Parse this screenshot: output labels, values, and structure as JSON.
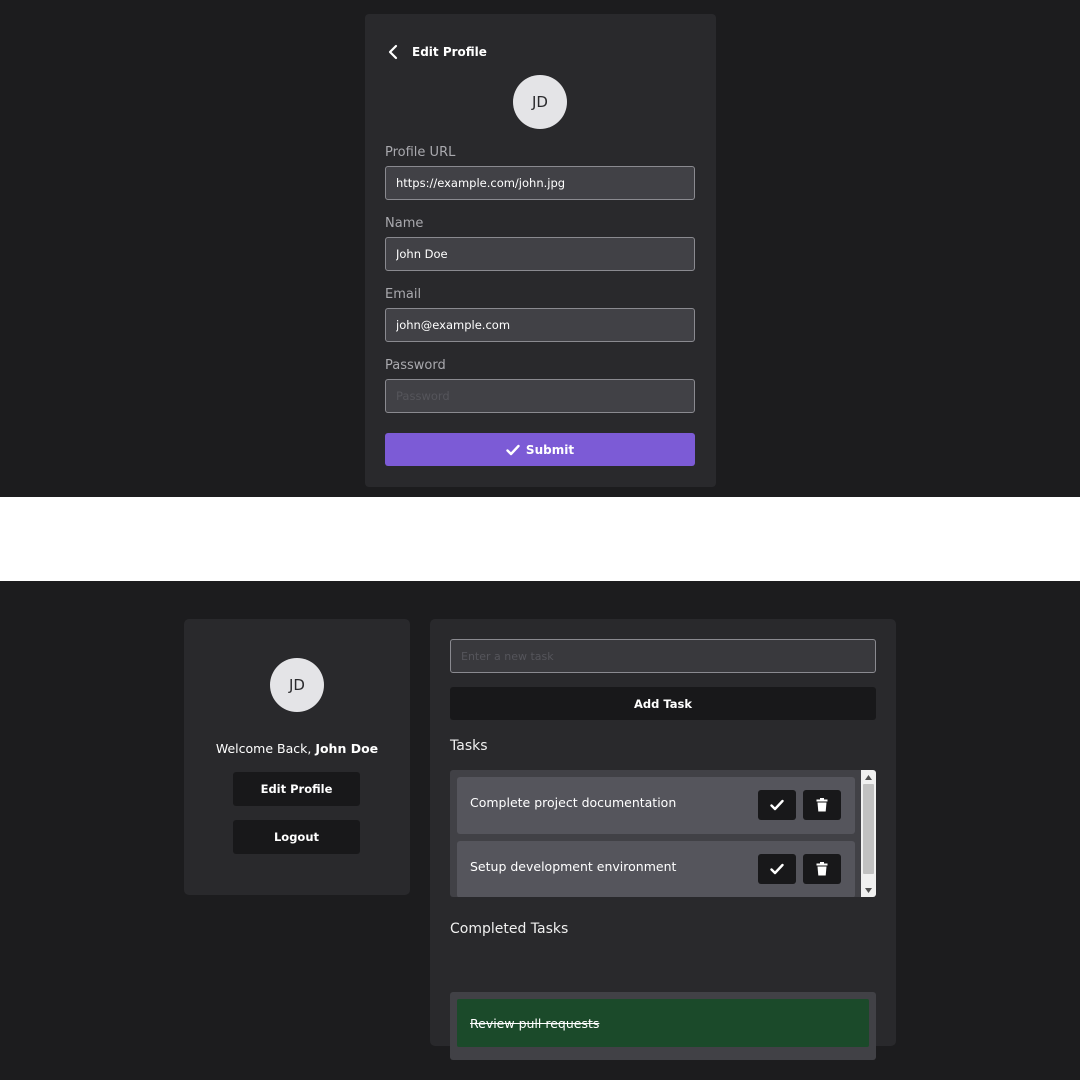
{
  "edit_profile": {
    "title": "Edit Profile",
    "avatar_initials": "JD",
    "fields": {
      "profile_url": {
        "label": "Profile URL",
        "value": "https://example.com/john.jpg"
      },
      "name": {
        "label": "Name",
        "value": "John Doe"
      },
      "email": {
        "label": "Email",
        "value": "john@example.com"
      },
      "password": {
        "label": "Password",
        "value": "",
        "placeholder": "Password"
      }
    },
    "submit_label": "Submit"
  },
  "dashboard": {
    "profile": {
      "avatar_initials": "JD",
      "welcome_prefix": "Welcome Back,",
      "user_name": "John Doe",
      "edit_profile_label": "Edit Profile",
      "logout_label": "Logout"
    },
    "new_task": {
      "value": "",
      "placeholder": "Enter a new task"
    },
    "add_task_label": "Add Task",
    "tasks_heading": "Tasks",
    "tasks": [
      {
        "text": "Complete project documentation"
      },
      {
        "text": "Setup development environment"
      }
    ],
    "completed_heading": "Completed Tasks",
    "completed_tasks": [
      {
        "text": "Review pull requests"
      }
    ]
  },
  "colors": {
    "background": "#1c1c1e",
    "card": "#29292c",
    "accent": "#7c5bd6",
    "completed": "#1b4a2a"
  },
  "icons": {
    "back": "chevron-left-icon",
    "submit": "check-icon",
    "complete": "check-icon",
    "delete": "trash-icon"
  }
}
